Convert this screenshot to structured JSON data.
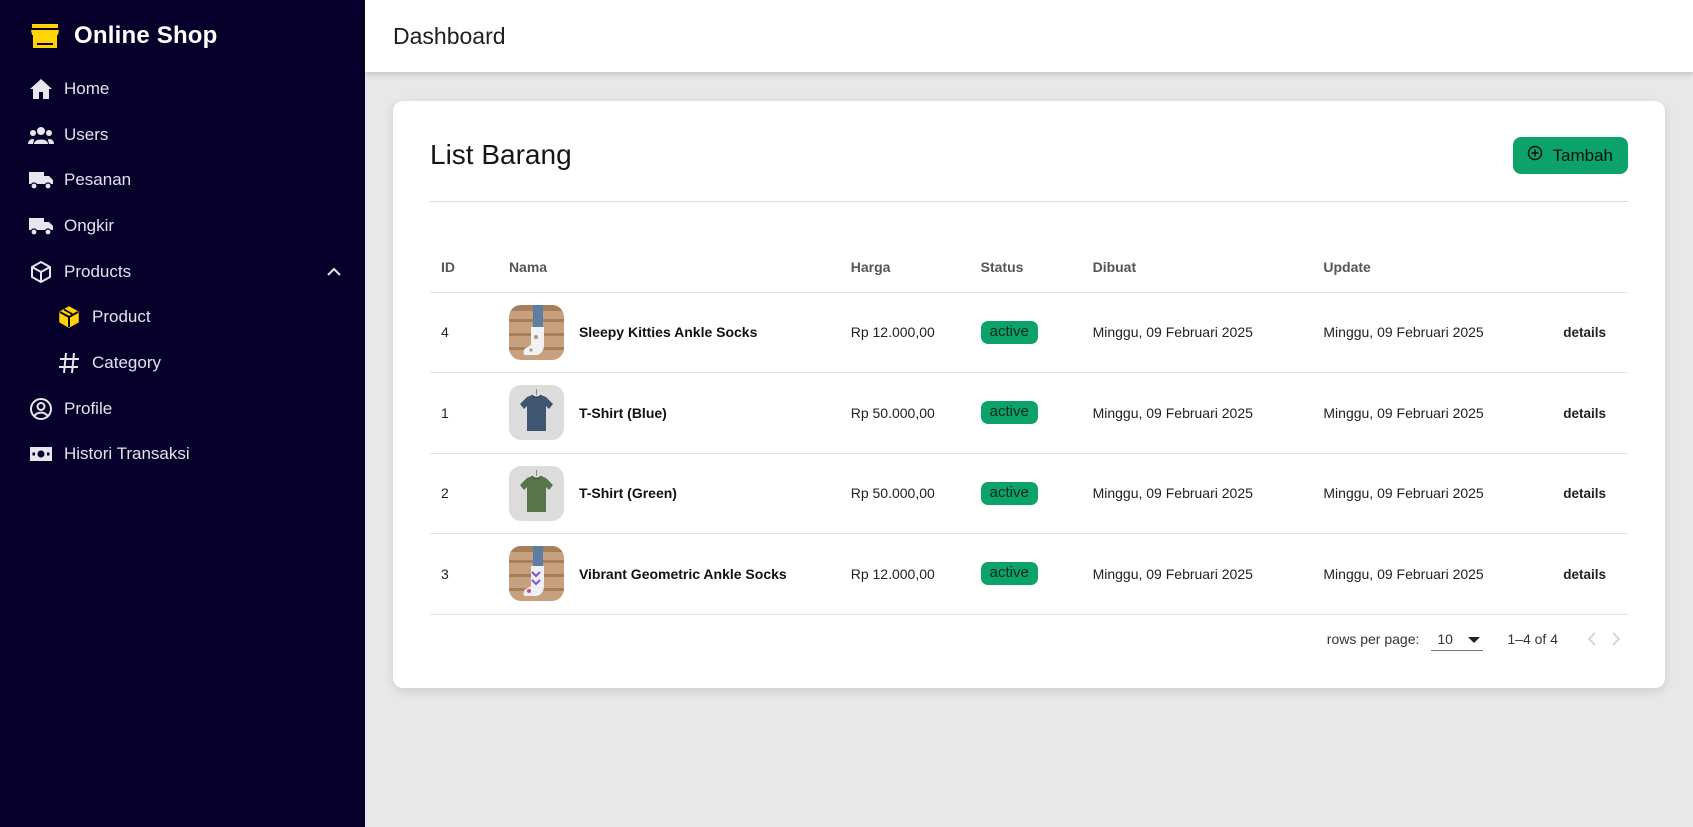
{
  "app": {
    "brand": "Online Shop",
    "accent": "#ffd400"
  },
  "sidebar": {
    "items": [
      {
        "label": "Home",
        "icon": "home-icon"
      },
      {
        "label": "Users",
        "icon": "users-icon"
      },
      {
        "label": "Pesanan",
        "icon": "truck-icon"
      },
      {
        "label": "Ongkir",
        "icon": "truck-icon"
      },
      {
        "label": "Products",
        "icon": "box-icon",
        "expanded": true
      },
      {
        "label": "Product",
        "icon": "cube-icon",
        "sub": true
      },
      {
        "label": "Category",
        "icon": "hash-icon",
        "sub": true
      },
      {
        "label": "Profile",
        "icon": "user-circle-icon"
      },
      {
        "label": "Histori Transaksi",
        "icon": "money-icon"
      }
    ]
  },
  "header": {
    "title": "Dashboard"
  },
  "card": {
    "title": "List Barang",
    "add_label": "Tambah",
    "status_color": "#0ca36b"
  },
  "table": {
    "columns": [
      "ID",
      "Nama",
      "Harga",
      "Status",
      "Dibuat",
      "Update",
      ""
    ],
    "rows": [
      {
        "id": "4",
        "name": "Sleepy Kitties Ankle Socks",
        "price": "Rp 12.000,00",
        "status": "active",
        "created": "Minggu, 09 Februari 2025",
        "updated": "Minggu, 09 Februari 2025",
        "action": "details",
        "thumb": "socks"
      },
      {
        "id": "1",
        "name": "T-Shirt (Blue)",
        "price": "Rp 50.000,00",
        "status": "active",
        "created": "Minggu, 09 Februari 2025",
        "updated": "Minggu, 09 Februari 2025",
        "action": "details",
        "thumb": "shirt-blue"
      },
      {
        "id": "2",
        "name": "T-Shirt (Green)",
        "price": "Rp 50.000,00",
        "status": "active",
        "created": "Minggu, 09 Februari 2025",
        "updated": "Minggu, 09 Februari 2025",
        "action": "details",
        "thumb": "shirt-green"
      },
      {
        "id": "3",
        "name": "Vibrant Geometric Ankle Socks",
        "price": "Rp 12.000,00",
        "status": "active",
        "created": "Minggu, 09 Februari 2025",
        "updated": "Minggu, 09 Februari 2025",
        "action": "details",
        "thumb": "socks-geo"
      }
    ]
  },
  "pagination": {
    "rows_label": "rows per page:",
    "rows_value": "10",
    "range": "1–4 of 4"
  }
}
